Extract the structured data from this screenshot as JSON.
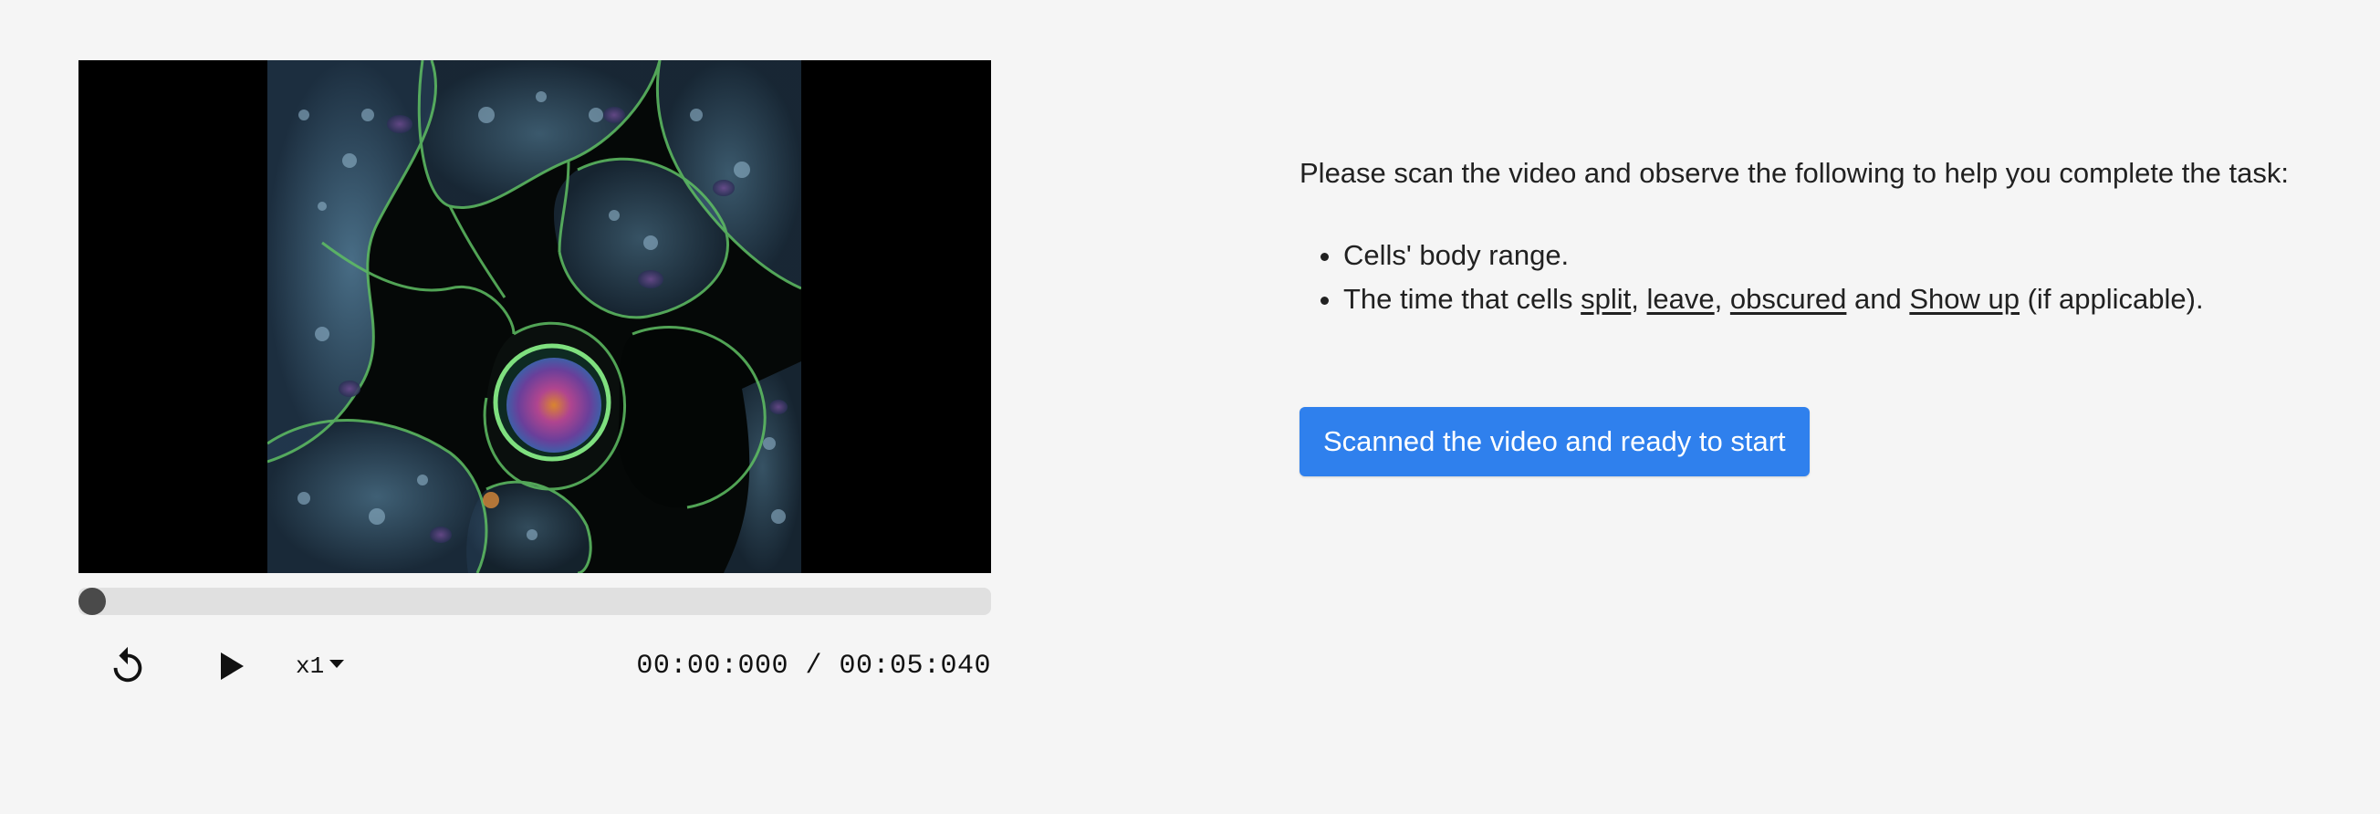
{
  "player": {
    "progress_fraction": 0,
    "speed_label": "x1",
    "time": {
      "current": "00:00:000",
      "separator": " / ",
      "total": "00:05:040"
    }
  },
  "instructions": {
    "intro": "Please scan the video and observe the following to help you complete the task:",
    "item1": "Cells' body range.",
    "item2": {
      "prefix": "The time that cells ",
      "term1": "split",
      "sep1": ", ",
      "term2": "leave",
      "sep2": ", ",
      "term3": "obscured",
      "sep3": " and ",
      "term4": "Show up",
      "suffix": " (if applicable)."
    }
  },
  "start_button_label": "Scanned the video and ready to start",
  "colors": {
    "background": "#f5f5f5",
    "accent": "#2f80ed",
    "video_background": "#000000",
    "track": "#e0e0e0",
    "thumb": "#4a4a4a"
  },
  "icons": {
    "replay": "replay-icon",
    "play": "play-icon",
    "speed_dropdown": "caret-down-icon"
  }
}
